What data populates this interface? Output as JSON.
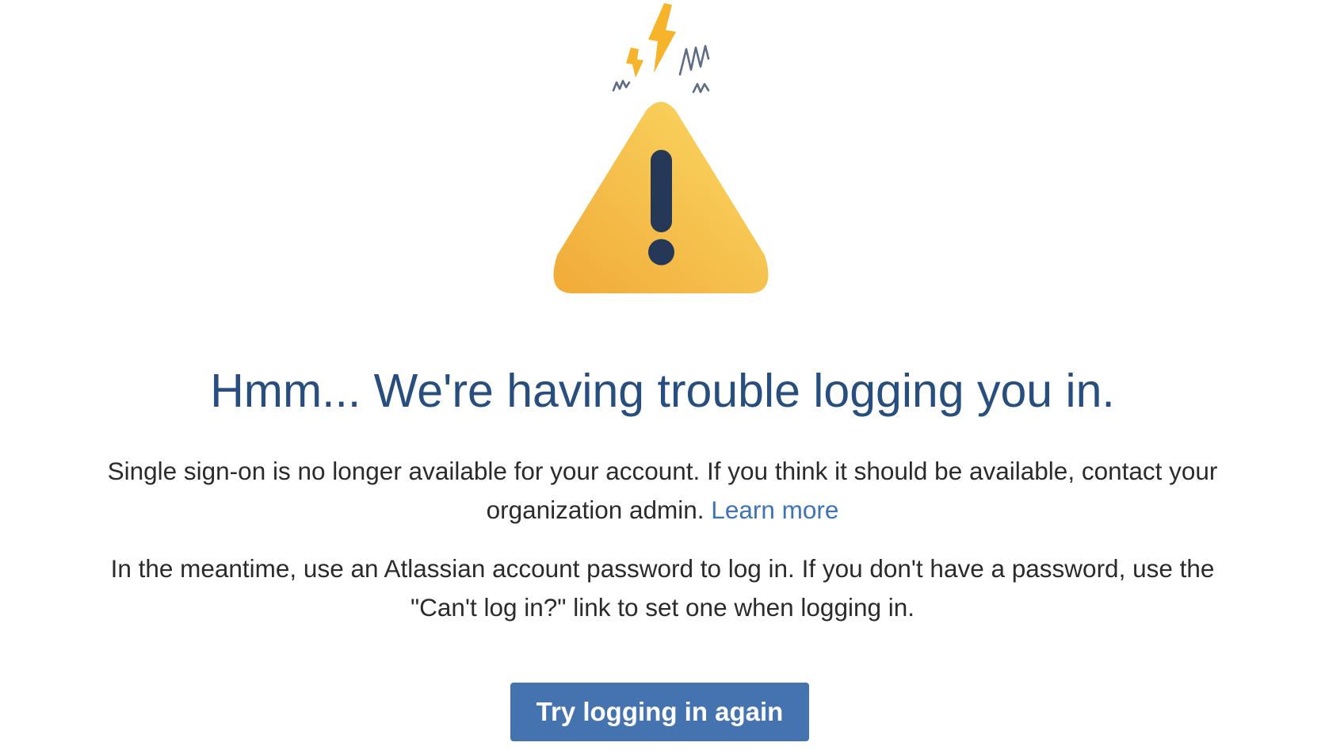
{
  "illustration": {
    "icon": "warning-triangle-icon",
    "colors": {
      "triangle_start": "#f1aa38",
      "triangle_end": "#fbd964",
      "exclamation": "#253858",
      "bolt": "#f5b42a",
      "squiggle": "#5e6c84"
    }
  },
  "heading": "Hmm... We're having trouble logging you in.",
  "message": {
    "line_1": "Single sign-on is no longer available for your account. If you think it should be available, contact your organization admin.",
    "learn_more_label": "Learn more",
    "line_2": "In the meantime, use an Atlassian account password to log in. If you don't have a password, use the \"Can't log in?\" link to set one when logging in."
  },
  "actions": {
    "retry_label": "Try logging in again"
  },
  "colors": {
    "heading": "#274e7e",
    "body_text": "#2b2b2b",
    "link": "#3e73b5",
    "button_bg": "#4573b0",
    "button_text": "#ffffff"
  }
}
